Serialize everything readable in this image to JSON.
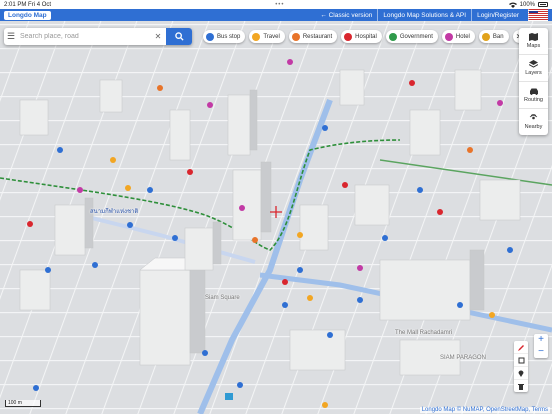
{
  "status": {
    "time": "2:01 PM",
    "date": "Fri 4 Oct",
    "dots": "•••",
    "battery": "100%"
  },
  "topbar": {
    "logo": "Longdo Map",
    "links": [
      "← Classic version",
      "Longdo Map Solutions & API",
      "Login/Register"
    ]
  },
  "search": {
    "placeholder": "Search place, road",
    "value": ""
  },
  "chips": [
    {
      "label": "Bus stop",
      "color": "#2f6fd3"
    },
    {
      "label": "Travel",
      "color": "#f2a623"
    },
    {
      "label": "Restaurant",
      "color": "#e8742a"
    },
    {
      "label": "Hospital",
      "color": "#d9262e"
    },
    {
      "label": "Government",
      "color": "#2f9a4a"
    },
    {
      "label": "Hotel",
      "color": "#c23aa5"
    },
    {
      "label": "Ban",
      "color": "#e1a21b"
    }
  ],
  "chips_more": "≫",
  "side": [
    {
      "label": "Maps",
      "icon": "map-icon"
    },
    {
      "label": "Layers",
      "icon": "layers-icon"
    },
    {
      "label": "Routing",
      "icon": "car-icon"
    },
    {
      "label": "Nearby",
      "icon": "nearby-icon"
    }
  ],
  "zoom": {
    "in": "+",
    "out": "−"
  },
  "scale": "100 m",
  "map_labels": [
    "สนามกีฬาแห่งชาติ",
    "The Mall Rachadamri",
    "SIAM PARAGON",
    "Siam Square"
  ],
  "attribution": {
    "prefix": "Longdo Map",
    "sources": "© NuMAP, OpenStreetMap, Terms"
  }
}
